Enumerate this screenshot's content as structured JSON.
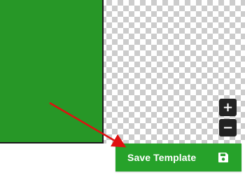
{
  "canvas": {
    "panel_color": "#279727"
  },
  "zoom": {
    "in_label": "+",
    "out_label": "−"
  },
  "save": {
    "label": "Save Template",
    "icon": "floppy-disk-icon",
    "bg_color": "#26a22a"
  },
  "annotation": {
    "arrow_color": "#e01010",
    "arrow_icon": "red-arrow-pointer"
  }
}
